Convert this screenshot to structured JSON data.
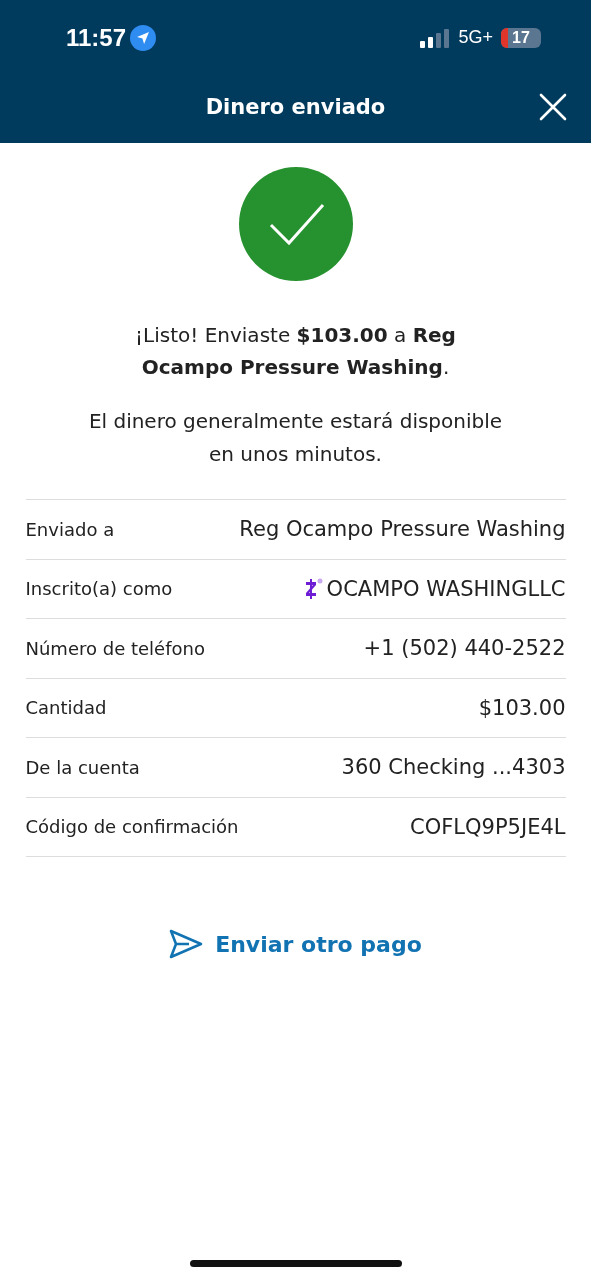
{
  "status_bar": {
    "time": "11:57",
    "network": "5G+",
    "battery": "17"
  },
  "header": {
    "title": "Dinero enviado"
  },
  "message": "¡Listo! Enviaste **$103.00** a **Reg Ocampo Pressure Washing**.",
  "note": "El dinero generalmente estará disponible en unos minutos.",
  "details": [
    {
      "kind": "plain",
      "label": "Enviado a",
      "value": "Reg Ocampo Pressure Washing"
    },
    {
      "kind": "enrolled",
      "label": "Inscrito(a) como",
      "value": "OCAMPO WASHINGLLC"
    },
    {
      "kind": "plain",
      "label": "Número de teléfono",
      "value": "+1 (502) 440-2522"
    },
    {
      "kind": "plain",
      "label": "Cantidad",
      "value": "$103.00"
    },
    {
      "kind": "plain",
      "label": "De la cuenta",
      "value": "360 Checking ...4303"
    },
    {
      "kind": "plain",
      "label": "Código de confirmación",
      "value": "COFLQ9P5JE4L"
    }
  ],
  "action": {
    "label": "Enviar otro pago"
  }
}
